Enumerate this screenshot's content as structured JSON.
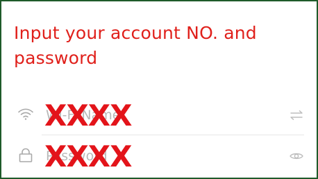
{
  "title": "Input your account NO. and password",
  "wifi_row": {
    "placeholder": "Wi-Fi Name",
    "redaction": "XXXX",
    "leading_icon": "wifi-icon",
    "trailing_icon": "swap-arrows-icon"
  },
  "password_row": {
    "placeholder": "Password",
    "redaction": "XXXX",
    "leading_icon": "lock-icon",
    "trailing_icon": "eye-icon"
  },
  "colors": {
    "title": "#e0201b",
    "redaction": "#e3141a",
    "border": "#1f5a2a",
    "placeholder": "#b9b9b9"
  }
}
